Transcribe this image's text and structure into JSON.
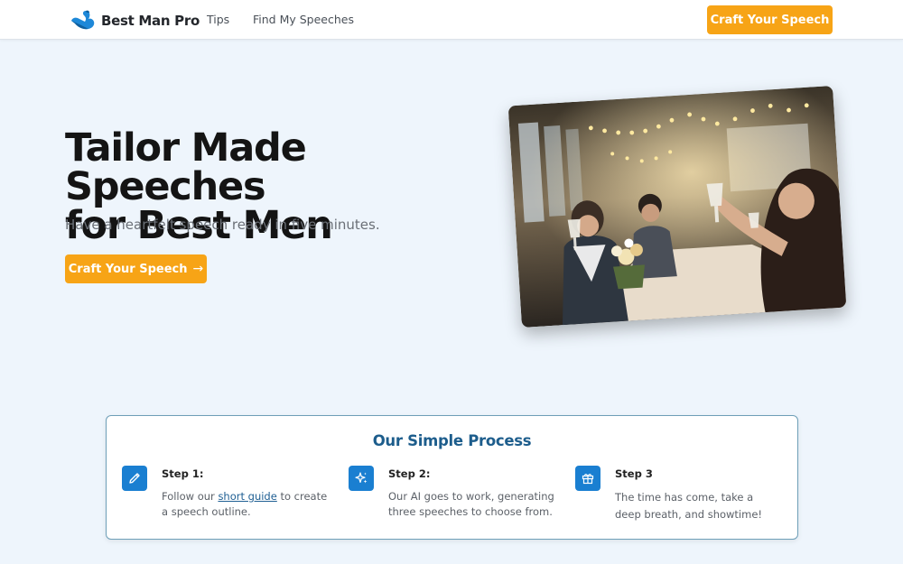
{
  "nav": {
    "brand": "Best Man Pro",
    "links": [
      "Tips",
      "Find My Speeches"
    ],
    "cta": "Craft Your Speech"
  },
  "hero": {
    "title_line1": "Tailor Made Speeches",
    "title_line2": "for Best Men",
    "subtitle": "Have a heartfelt speech ready in five minutes.",
    "cta": "Craft Your Speech",
    "cta_arrow": "→"
  },
  "process": {
    "title": "Our Simple Process",
    "steps": [
      {
        "title": "Step 1:",
        "desc_before": "Follow our ",
        "desc_link": "short guide",
        "desc_after": " to create a speech outline.",
        "icon": "pencil-icon"
      },
      {
        "title": "Step 2:",
        "desc": "Our AI goes to work, generating three speeches to choose from.",
        "icon": "sparkles-icon"
      },
      {
        "title": "Step 3",
        "desc": "The time has come, take a deep breath, and showtime!",
        "icon": "gift-icon"
      }
    ]
  },
  "colors": {
    "accent": "#f7a416",
    "brand_blue": "#1a7fd1",
    "page_bg": "#eef5fc",
    "process_title": "#1d5d8c"
  }
}
